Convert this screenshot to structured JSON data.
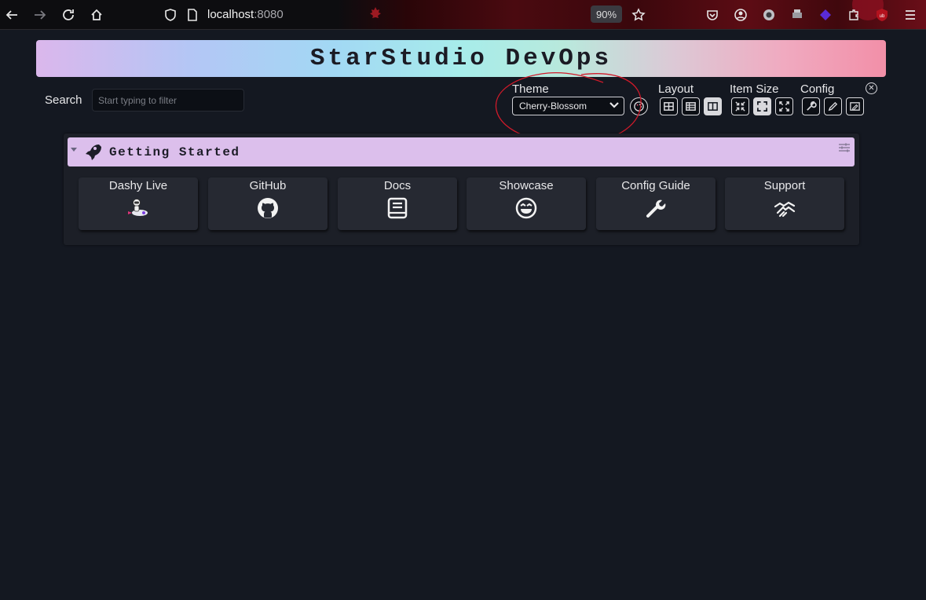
{
  "browser": {
    "url_host": "localhost",
    "url_port": ":8080",
    "zoom": "90%"
  },
  "header": {
    "title": "StarStudio DevOps"
  },
  "search": {
    "label": "Search",
    "placeholder": "Start typing to filter"
  },
  "settings": {
    "theme_label": "Theme",
    "theme_value": "Cherry-Blossom",
    "layout_label": "Layout",
    "item_size_label": "Item Size",
    "config_label": "Config"
  },
  "section": {
    "title": "Getting Started",
    "items": [
      {
        "label": "Dashy Live",
        "icon": "astronaut-rocket-icon"
      },
      {
        "label": "GitHub",
        "icon": "github-icon"
      },
      {
        "label": "Docs",
        "icon": "book-icon"
      },
      {
        "label": "Showcase",
        "icon": "heart-eyes-smiley-icon"
      },
      {
        "label": "Config Guide",
        "icon": "wrench-icon"
      },
      {
        "label": "Support",
        "icon": "handshake-icon"
      }
    ]
  },
  "colors": {
    "page_bg": "#141821",
    "section_header": "#dcbfec",
    "item_bg": "#262932",
    "annotation": "#d01a2a"
  }
}
